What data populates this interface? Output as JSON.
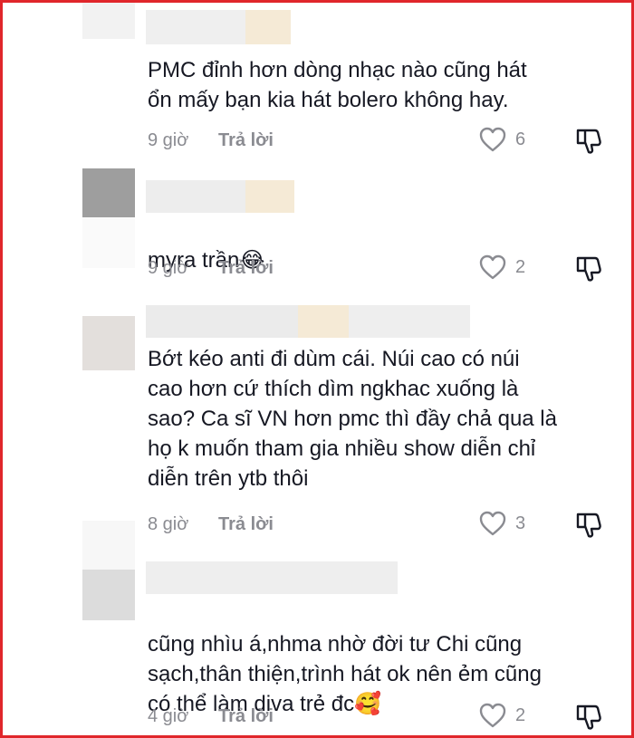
{
  "comments": [
    {
      "text": "PMC đỉnh hơn dòng nhạc nào cũng hát\nổn mấy bạn kia hát bolero không hay.",
      "time": "9 giờ",
      "reply_label": "Trả lời",
      "likes": "6"
    },
    {
      "text": "myra trần",
      "emoji": "😂",
      "time": "9 giờ",
      "reply_label": "Trả lời",
      "likes": "2"
    },
    {
      "text": "Bớt kéo anti đi dùm cái. Núi cao có núi\ncao hơn cứ thích dìm ngkhac xuống là\nsao? Ca sĩ VN hơn pmc thì đầy chả qua là\nhọ k muốn tham gia nhiều show diễn chỉ\ndiễn trên ytb thôi",
      "time": "8 giờ",
      "reply_label": "Trả lời",
      "likes": "3"
    },
    {
      "text": "cũng nhìu á,nhma nhờ đời tư Chi cũng\nsạch,thân thiện,trình hát ok nên ẻm cũng\ncó thể làm diva trẻ đc",
      "emoji": "🥰",
      "time": "4 giờ",
      "reply_label": "Trả lời",
      "likes": "2"
    }
  ],
  "colors": {
    "border": "#e0262b",
    "text": "#161823",
    "meta": "#8a8b91",
    "blur_light": "#efefef",
    "blur_mid": "#e6e6e6",
    "blur_dark": "#9e9e9e",
    "blur_beige": "#f5ead6"
  },
  "icons": [
    "heart-outline-icon",
    "thumbs-down-icon"
  ]
}
